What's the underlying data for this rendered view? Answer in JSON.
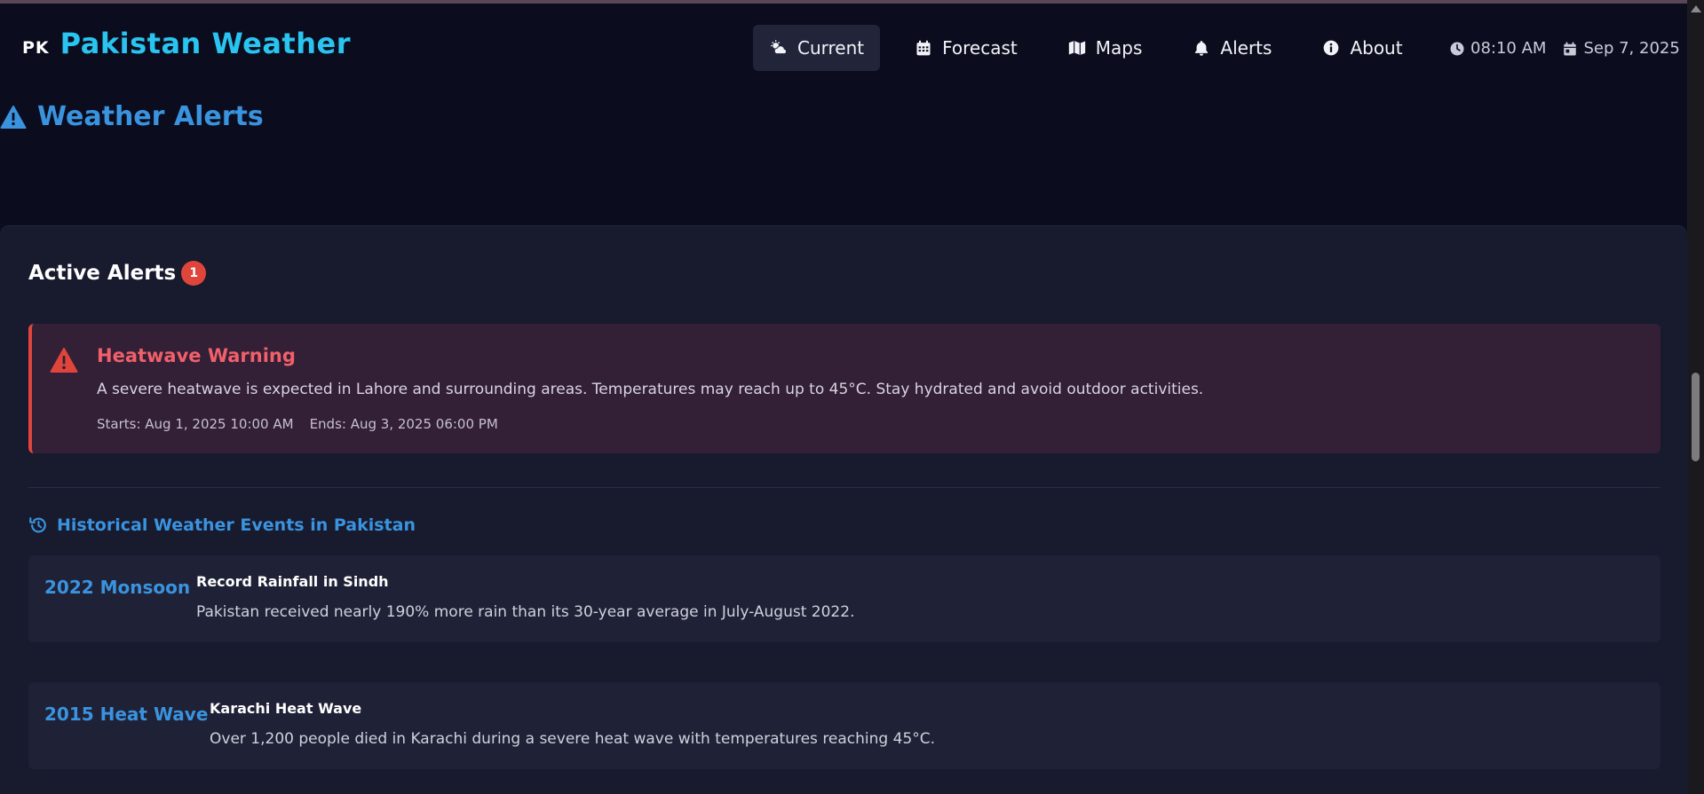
{
  "header": {
    "flag": "PK",
    "title": "Pakistan Weather",
    "nav": [
      {
        "label": "Current",
        "icon": "cloud-sun-icon",
        "active": true
      },
      {
        "label": "Forecast",
        "icon": "calendar-icon",
        "active": false
      },
      {
        "label": "Maps",
        "icon": "map-icon",
        "active": false
      },
      {
        "label": "Alerts",
        "icon": "bell-icon",
        "active": false
      },
      {
        "label": "About",
        "icon": "info-circle-icon",
        "active": false
      }
    ],
    "time": "08:10 AM",
    "date": "Sep 7, 2025"
  },
  "page": {
    "title": "Weather Alerts"
  },
  "active_alerts": {
    "title": "Active Alerts",
    "count": "1",
    "alerts": [
      {
        "title": "Heatwave Warning",
        "description": "A severe heatwave is expected in Lahore and surrounding areas. Temperatures may reach up to 45°C. Stay hydrated and avoid outdoor activities.",
        "starts": "Starts: Aug 1, 2025 10:00 AM",
        "ends": "Ends: Aug 3, 2025 06:00 PM"
      }
    ]
  },
  "history": {
    "title": "Historical Weather Events in Pakistan",
    "events": [
      {
        "year": "2022 Monsoon",
        "title": "Record Rainfall in Sindh",
        "description": "Pakistan received nearly 190% more rain than its 30-year average in July-August 2022."
      },
      {
        "year": "2015 Heat Wave",
        "title": "Karachi Heat Wave",
        "description": "Over 1,200 people died in Karachi during a severe heat wave with temperatures reaching 45°C."
      }
    ]
  },
  "colors": {
    "background": "#0b0d1e",
    "card": "#181a2e",
    "accent_blue": "#3a93de",
    "brand_cyan": "#29c4f0",
    "danger": "#e0453c"
  }
}
